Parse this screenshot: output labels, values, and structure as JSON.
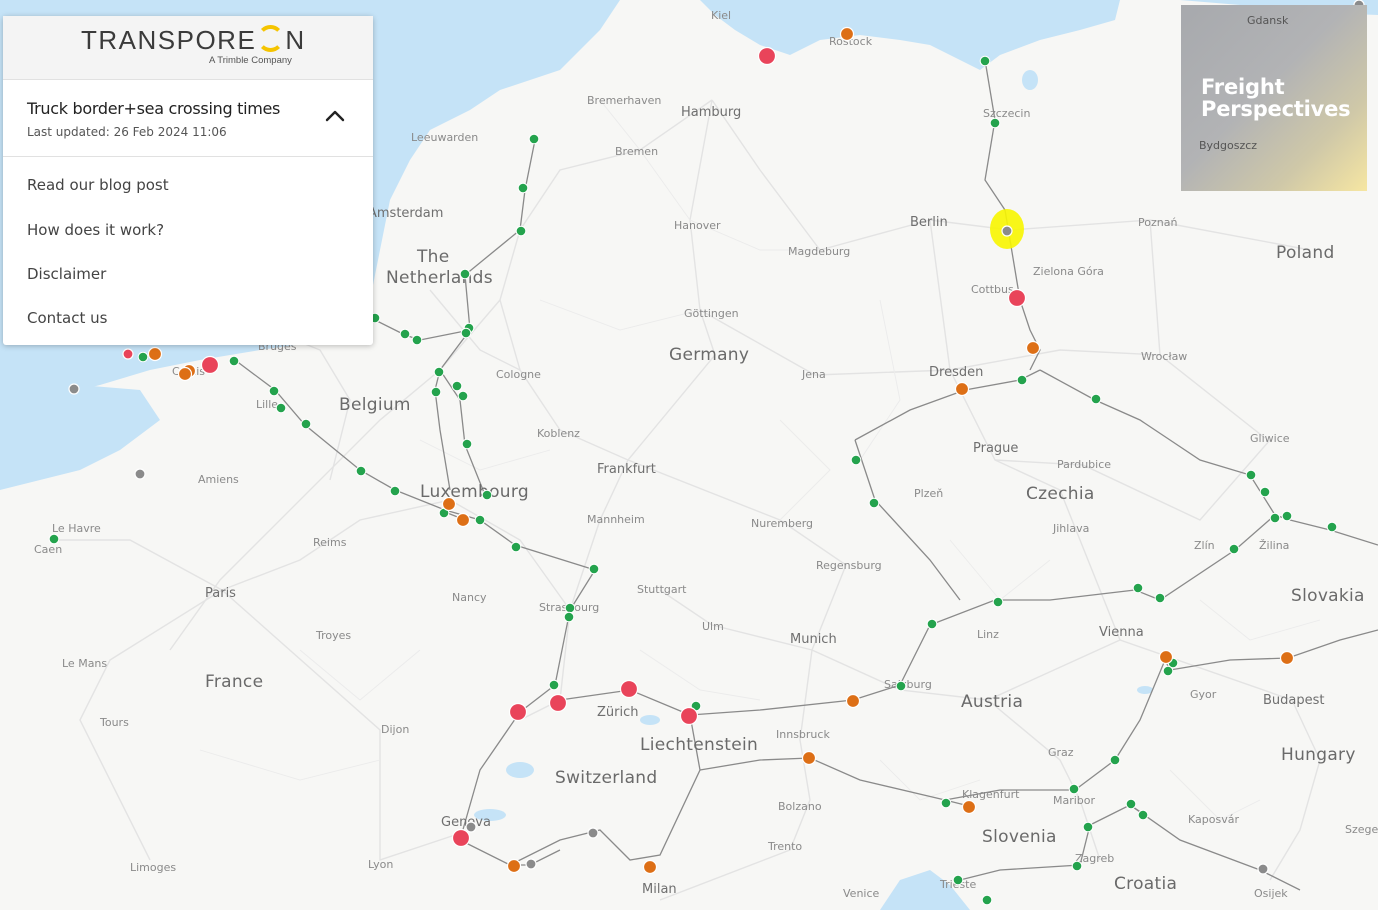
{
  "header": {
    "logo_text": "TRANSPORE",
    "logo_tail": "N",
    "tagline": "A Trimble Company"
  },
  "panel": {
    "title": "Truck border+sea crossing times",
    "last_updated": "Last updated: 26 Feb 2024 11:06",
    "links": [
      "Read our blog post",
      "How does it work?",
      "Disclaimer",
      "Contact us"
    ]
  },
  "badge": {
    "title_line1": "Freight",
    "title_line2": "Perspectives",
    "map_labels": [
      "Gdansk",
      "Bydgoszcz"
    ]
  },
  "colors": {
    "green": "#24a34d",
    "orange": "#dd6f16",
    "red": "#e9445a",
    "gray": "#8b8b8b",
    "highlight": "#f7f500",
    "water": "#c5e3f7",
    "land": "#f7f7f5"
  },
  "map": {
    "countries": [
      "Germany",
      "France",
      "Belgium",
      "The",
      "Netherlands",
      "Luxembourg",
      "Switzerland",
      "Liechtenstein",
      "Austria",
      "Czechia",
      "Poland",
      "Slovakia",
      "Hungary",
      "Slovenia",
      "Croatia"
    ],
    "cities": [
      "Hamburg",
      "Berlin",
      "Bremen",
      "Bremerhaven",
      "Hanover",
      "Magdeburg",
      "Kiel",
      "Rostock",
      "Szczecin",
      "Poznań",
      "Zielona Góra",
      "Cottbus",
      "Dresden",
      "Wrocław",
      "Göttingen",
      "Jena",
      "Cologne",
      "Koblenz",
      "Frankfurt",
      "Mannheim",
      "Nuremberg",
      "Regensburg",
      "Stuttgart",
      "Ulm",
      "Munich",
      "Strasbourg",
      "Zürich",
      "Innsbruck",
      "Bolzano",
      "Trento",
      "Milan",
      "Venice",
      "Trieste",
      "Zagreb",
      "Maribor",
      "Graz",
      "Klagenfurt",
      "Linz",
      "Salzburg",
      "Vienna",
      "Prague",
      "Plzeň",
      "Pardubice",
      "Jihlava",
      "Zlín",
      "Žilina",
      "Gliwice",
      "Gyor",
      "Budapest",
      "Kaposvár",
      "Osijek",
      "Szeged",
      "Paris",
      "Reims",
      "Nancy",
      "Troyes",
      "Dijon",
      "Lyon",
      "Geneva",
      "Le Mans",
      "Tours",
      "Limoges",
      "Amiens",
      "Le Havre",
      "Caen",
      "Lille",
      "Calais",
      "Bruges",
      "Leeuwarden",
      "Amsterdam",
      "Poznan"
    ],
    "legend_statuses": [
      "green",
      "orange",
      "red",
      "gray"
    ]
  }
}
